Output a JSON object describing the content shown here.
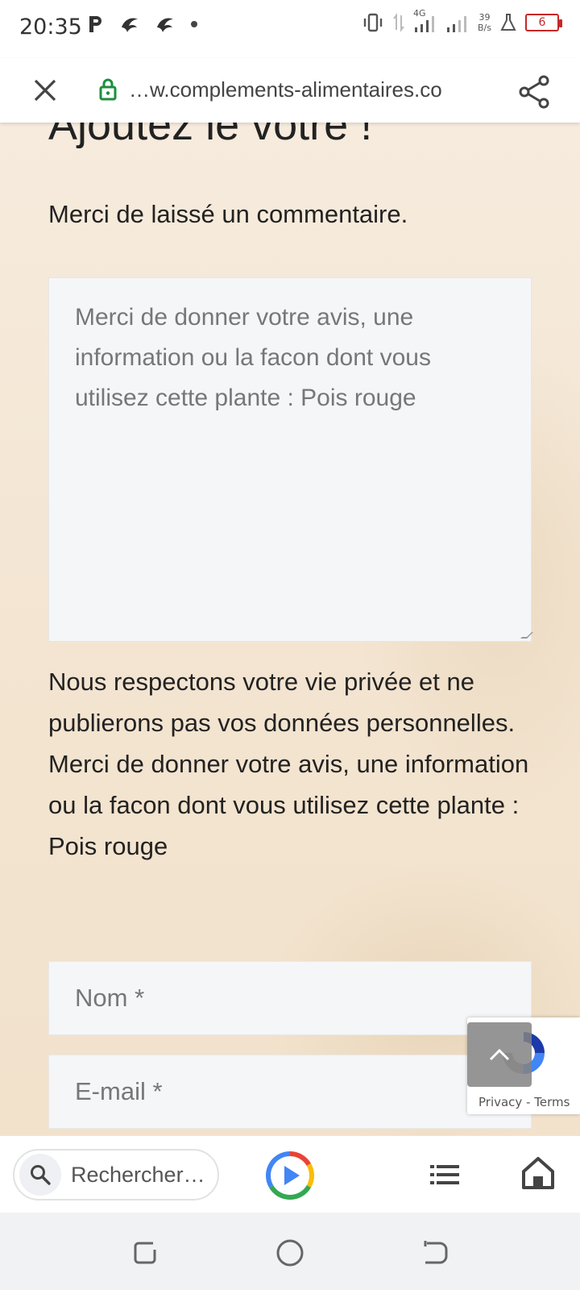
{
  "status_bar": {
    "time": "20:35",
    "network_type": "4G",
    "net_speed_value": "39",
    "net_speed_unit": "B/s",
    "battery_level": "6"
  },
  "browser": {
    "url": "…w.complements-alimentaires.co"
  },
  "page": {
    "heading": "Ajoutez le votre !",
    "intro": "Merci de laissé un commentaire.",
    "comment_placeholder": "Merci de donner votre avis, une information ou la facon dont vous utilisez cette plante : Pois rouge",
    "privacy_line1": "Nous respectons votre vie privée et ne publierons pas vos données personnelles.",
    "privacy_line2": "Merci de donner votre avis, une information ou la facon dont vous utilisez cette plante : Pois rouge",
    "name_placeholder": "Nom *",
    "email_placeholder": "E-mail *"
  },
  "recaptcha": {
    "privacy": "Privacy",
    "separator": "-",
    "terms": "Terms"
  },
  "bottom_bar": {
    "search_placeholder": "Rechercher…"
  },
  "colors": {
    "accent_green": "#1e8e3e",
    "battery_red": "#c62828",
    "page_bg": "#f5e8d8"
  }
}
